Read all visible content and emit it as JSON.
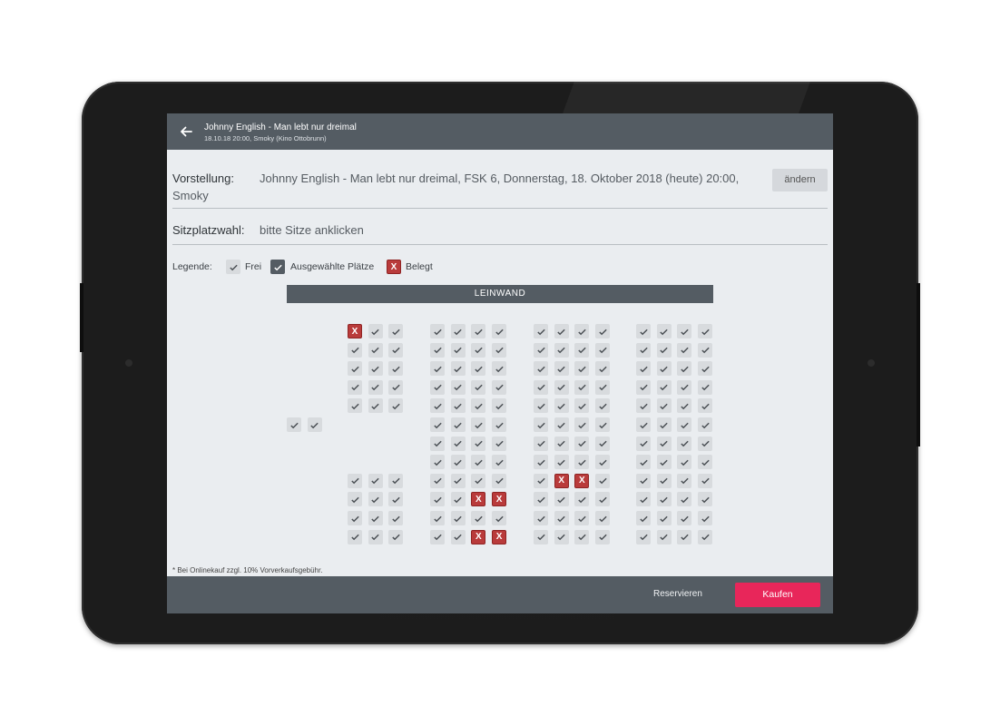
{
  "header": {
    "title": "Johnny English - Man lebt nur dreimal",
    "subtitle": "18.10.18 20:00, Smoky (Kino Ottobrunn)"
  },
  "vorstellung": {
    "label": "Vorstellung:",
    "text_line1": "Johnny English - Man lebt nur dreimal, FSK 6, Donnerstag, 18. Oktober 2018 (heute) 20:00,",
    "text_line2": "Smoky",
    "change_button": "ändern"
  },
  "sitzplatz": {
    "label": "Sitzplatzwahl:",
    "hint": "bitte Sitze anklicken"
  },
  "legend": {
    "title": "Legende:",
    "free": "Frei",
    "selected": "Ausgewählte Plätze",
    "taken": "Belegt",
    "taken_mark": "X"
  },
  "screen_label": "LEINWAND",
  "seating": {
    "rows": 12,
    "taken_mark": "X",
    "blocks": [
      {
        "name": "block-left",
        "seats_per_row": 3,
        "rows_present": [
          1,
          2,
          3,
          4,
          5,
          9,
          10,
          11,
          12
        ],
        "taken": [
          [
            1,
            1
          ]
        ]
      },
      {
        "name": "block-center-left",
        "seats_per_row": 4,
        "rows_present": [
          1,
          2,
          3,
          4,
          5,
          6,
          7,
          8,
          9,
          10,
          11,
          12
        ],
        "taken": [
          [
            10,
            3
          ],
          [
            10,
            4
          ],
          [
            12,
            3
          ],
          [
            12,
            4
          ]
        ]
      },
      {
        "name": "block-center-right",
        "seats_per_row": 4,
        "rows_present": [
          1,
          2,
          3,
          4,
          5,
          6,
          7,
          8,
          9,
          10,
          11,
          12
        ],
        "taken": [
          [
            9,
            2
          ],
          [
            9,
            3
          ]
        ]
      },
      {
        "name": "block-right",
        "seats_per_row": 4,
        "rows_present": [
          1,
          2,
          3,
          4,
          5,
          6,
          7,
          8,
          9,
          10,
          11,
          12
        ],
        "taken": []
      },
      {
        "name": "block-side",
        "seats_per_row": 2,
        "rows_present": [
          6
        ],
        "taken": []
      }
    ]
  },
  "footnote": "* Bei Onlinekauf zzgl. 10% Vorverkaufsgebühr.",
  "footer": {
    "reserve_button": "Reservieren",
    "buy_button": "Kaufen"
  },
  "colors": {
    "bar": "#545c63",
    "taken": "#b93b3b",
    "buy": "#e8265a"
  }
}
